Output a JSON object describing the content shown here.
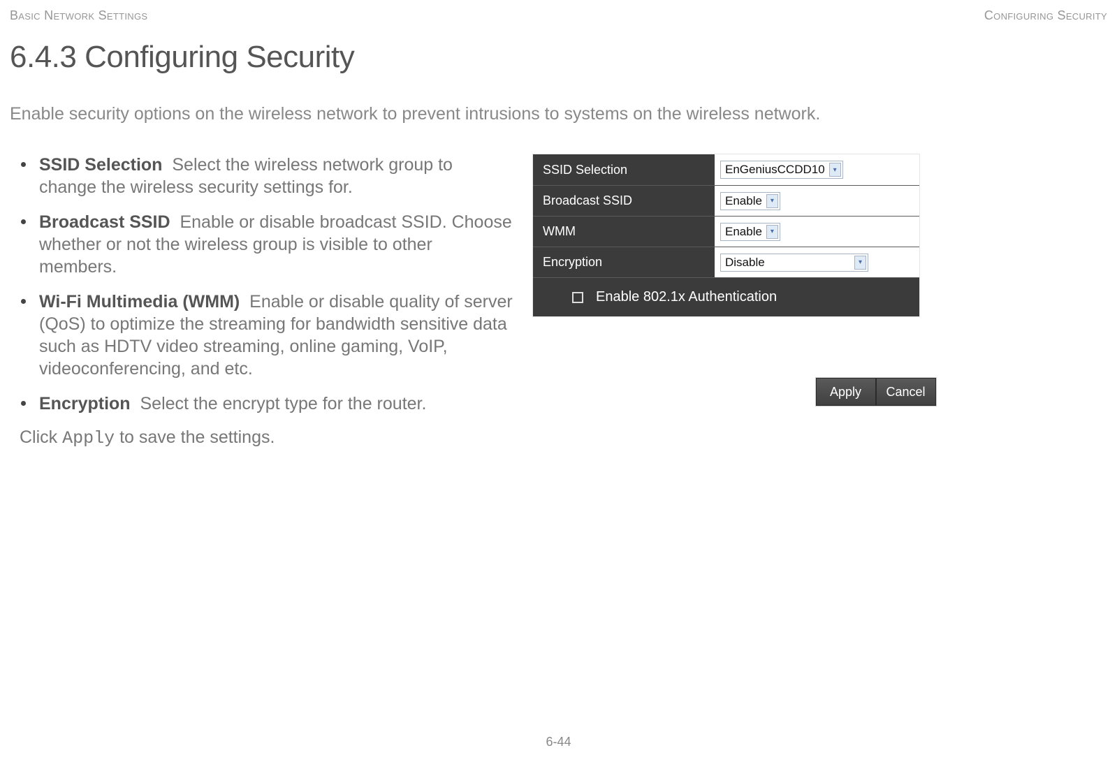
{
  "header": {
    "left": "Basic Network Settings",
    "right": "Configuring Security"
  },
  "title": "6.4.3 Configuring Security",
  "intro": "Enable security options on the wireless network to prevent intrusions to systems on the wireless network.",
  "definitions": [
    {
      "term": "SSID Selection",
      "desc": "Select the wireless network group to change the wireless security settings for."
    },
    {
      "term": "Broadcast SSID",
      "desc": "Enable or disable broadcast SSID. Choose whether or not the wireless group is visible to other members."
    },
    {
      "term": "Wi-Fi Multimedia (WMM)",
      "desc": "Enable or disable quality of server (QoS) to optimize the streaming for bandwidth sensitive data such as HDTV video streaming, online gaming, VoIP, videoconferencing, and etc."
    },
    {
      "term": "Encryption",
      "desc": "Select the encrypt type for the router."
    }
  ],
  "apply_line": {
    "pre": "Click ",
    "code": "Apply",
    "post": " to save the settings."
  },
  "panel": {
    "rows": [
      {
        "label": "SSID Selection",
        "value": "EnGeniusCCDD10",
        "wide": false
      },
      {
        "label": "Broadcast SSID",
        "value": "Enable",
        "wide": false
      },
      {
        "label": "WMM",
        "value": "Enable",
        "wide": false
      },
      {
        "label": "Encryption",
        "value": "Disable",
        "wide": true
      }
    ],
    "auth_label": "Enable 802.1x Authentication"
  },
  "buttons": {
    "apply": "Apply",
    "cancel": "Cancel"
  },
  "footer": "6-44"
}
